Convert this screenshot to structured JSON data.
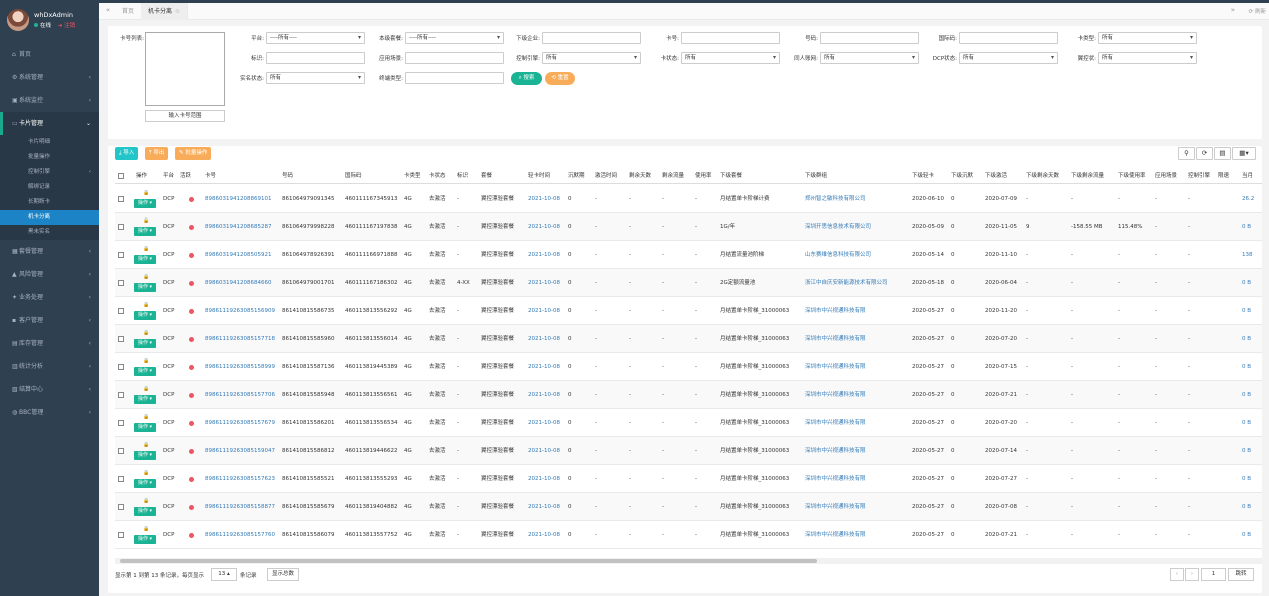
{
  "user": {
    "name": "whDxAdmin",
    "status": "在线",
    "logout": "注销"
  },
  "nav": {
    "items": [
      {
        "icon": "home-icon",
        "glyph": "⌂",
        "label": "首页",
        "arrow": ""
      },
      {
        "icon": "gear-icon",
        "glyph": "⚙",
        "label": "系统管理",
        "arrow": "‹"
      },
      {
        "icon": "video-icon",
        "glyph": "▣",
        "label": "系统监控",
        "arrow": "‹"
      },
      {
        "icon": "card-icon",
        "glyph": "▭",
        "label": "卡片管理",
        "arrow": "⌄"
      }
    ],
    "sub": [
      "卡片明细",
      "批量操作",
      "控制引擎",
      "解绑记录",
      "长期断卡",
      "机卡分离",
      "黑未实名"
    ],
    "sub_arrows": [
      "",
      "",
      "‹",
      "",
      "",
      "",
      ""
    ],
    "items2": [
      {
        "icon": "package-icon",
        "glyph": "▦",
        "label": "套餐管理",
        "arrow": "‹"
      },
      {
        "icon": "warning-icon",
        "glyph": "▲",
        "label": "风险管理",
        "arrow": "‹"
      },
      {
        "icon": "users-icon",
        "glyph": "✦",
        "label": "业务处理",
        "arrow": "‹"
      },
      {
        "icon": "customer-icon",
        "glyph": "▪",
        "label": "客户管理",
        "arrow": "‹"
      },
      {
        "icon": "warehouse-icon",
        "glyph": "▤",
        "label": "库存管理",
        "arrow": "‹"
      },
      {
        "icon": "chart-icon",
        "glyph": "▥",
        "label": "统计分析",
        "arrow": "‹"
      },
      {
        "icon": "settle-icon",
        "glyph": "▧",
        "label": "结算中心",
        "arrow": "‹"
      },
      {
        "icon": "globe-icon",
        "glyph": "◍",
        "label": "BBC管理",
        "arrow": "‹"
      }
    ]
  },
  "tabs": {
    "home": "首页",
    "active": "机卡分离",
    "refresh": "刷新"
  },
  "filters": {
    "card_list_label": "卡号列表:",
    "range_btn": "输入卡号范围",
    "platform": {
      "label": "平台:",
      "value": "----所有----"
    },
    "package": {
      "label": "本级套餐:",
      "value": "----所有----"
    },
    "lower_company": {
      "label": "下级企业:",
      "value": ""
    },
    "card_no": {
      "label": "卡号:",
      "value": ""
    },
    "number": {
      "label": "号码:",
      "value": ""
    },
    "iccid": {
      "label": "国际码:",
      "value": ""
    },
    "card_type": {
      "label": "卡类型:",
      "value": "所有"
    },
    "tag": {
      "label": "标识:",
      "value": ""
    },
    "scene": {
      "label": "应用场景:",
      "value": ""
    },
    "control_engine": {
      "label": "控制引擎:",
      "value": "所有"
    },
    "card_status": {
      "label": "卡状态:",
      "value": "所有"
    },
    "belong_pool": {
      "label": "同人账网:",
      "value": "所有"
    },
    "dcp_status": {
      "label": "DCP状态:",
      "value": "所有"
    },
    "wing_control": {
      "label": "翼控状:",
      "value": "所有"
    },
    "realname": {
      "label": "实名状态:",
      "value": "所有"
    },
    "terminal": {
      "label": "终端类型:",
      "value": ""
    },
    "search_btn": "搜索",
    "reset_btn": "重置"
  },
  "toolbar": {
    "import": "导入",
    "export": "导出",
    "batch": "批量操作"
  },
  "table": {
    "headers": [
      "操作",
      "平台",
      "活跃",
      "卡号",
      "号码",
      "国际码",
      "卡类型",
      "卡状态",
      "标识",
      "套餐",
      "轻卡时间",
      "沉默期",
      "激活时间",
      "剩余天数",
      "剩余流量",
      "使用率",
      "下级套餐",
      "下级群组",
      "下级轻卡",
      "下级沉默",
      "下级激活",
      "下级剩余天数",
      "下级剩余流量",
      "下级使用率",
      "应用场景",
      "控制引擎",
      "限速",
      "当月"
    ],
    "op_label": "操作",
    "rows": [
      [
        "DCP",
        "8986031941208869101",
        "861064979091345",
        "460111167345913",
        "4G",
        "去激活",
        "-",
        "翼控漂验套餐",
        "2021-10-08",
        "0",
        "-",
        "-",
        "-",
        "-",
        "月结置单卡阶梯计费",
        "郑州智之敏科技有限公司",
        "2020-06-10",
        "0",
        "2020-07-09",
        "-",
        "-",
        "-",
        "-",
        "-",
        "26.2"
      ],
      [
        "DCP",
        "8986031941208685287",
        "861064979998228",
        "460111167197838",
        "4G",
        "去激活",
        "-",
        "翼控漂验套餐",
        "2021-10-08",
        "0",
        "-",
        "-",
        "-",
        "-",
        "1G/年",
        "深圳开思信息技术有限公司",
        "2020-05-09",
        "0",
        "2020-11-05",
        "9",
        "-158.55 MB",
        "115.48%",
        "-",
        "-",
        "0 B"
      ],
      [
        "DCP",
        "8986031941208505921",
        "861064978926391",
        "460111166971888",
        "4G",
        "去激活",
        "-",
        "翼控漂验套餐",
        "2021-10-08",
        "0",
        "-",
        "-",
        "-",
        "-",
        "月结置流量池阶梯",
        "山东赛维信息科技有限公司",
        "2020-05-14",
        "0",
        "2020-11-10",
        "-",
        "-",
        "-",
        "-",
        "-",
        "138"
      ],
      [
        "DCP",
        "8986031941208684660",
        "861064979001701",
        "460111167186302",
        "4G",
        "去激活",
        "4-XX",
        "翼控漂验套餐",
        "2021-10-08",
        "0",
        "-",
        "-",
        "-",
        "-",
        "2G定额流量池",
        "浙江中自庆安新能源技术有限公司",
        "2020-05-18",
        "0",
        "2020-06-04",
        "-",
        "-",
        "-",
        "-",
        "-",
        "0 B"
      ],
      [
        "DCP",
        "89861119263085156909",
        "861410815586735",
        "460113813556292",
        "4G",
        "去激活",
        "-",
        "翼控漂验套餐",
        "2021-10-08",
        "0",
        "-",
        "-",
        "-",
        "-",
        "月结置单卡阶梯_31000063",
        "深圳市中兴视通科技有限",
        "2020-05-27",
        "0",
        "2020-11-20",
        "-",
        "-",
        "-",
        "-",
        "-",
        "0 B"
      ],
      [
        "DCP",
        "89861119263085157718",
        "861410815585960",
        "460113813556014",
        "4G",
        "去激活",
        "-",
        "翼控漂验套餐",
        "2021-10-08",
        "0",
        "-",
        "-",
        "-",
        "-",
        "月结置单卡阶梯_31000063",
        "深圳市中兴视通科技有限",
        "2020-05-27",
        "0",
        "2020-07-20",
        "-",
        "-",
        "-",
        "-",
        "-",
        "0 B"
      ],
      [
        "DCP",
        "89861119263085158999",
        "861410815587136",
        "460113819445389",
        "4G",
        "去激活",
        "-",
        "翼控漂验套餐",
        "2021-10-08",
        "0",
        "-",
        "-",
        "-",
        "-",
        "月结置单卡阶梯_31000063",
        "深圳市中兴视通科技有限",
        "2020-05-27",
        "0",
        "2020-07-15",
        "-",
        "-",
        "-",
        "-",
        "-",
        "0 B"
      ],
      [
        "DCP",
        "89861119263085157706",
        "861410815585948",
        "460113813556561",
        "4G",
        "去激活",
        "-",
        "翼控漂验套餐",
        "2021-10-08",
        "0",
        "-",
        "-",
        "-",
        "-",
        "月结置单卡阶梯_31000063",
        "深圳市中兴视通科技有限",
        "2020-05-27",
        "0",
        "2020-07-21",
        "-",
        "-",
        "-",
        "-",
        "-",
        "0 B"
      ],
      [
        "DCP",
        "89861119263085157679",
        "861410815586201",
        "460113813556534",
        "4G",
        "去激活",
        "-",
        "翼控漂验套餐",
        "2021-10-08",
        "0",
        "-",
        "-",
        "-",
        "-",
        "月结置单卡阶梯_31000063",
        "深圳市中兴视通科技有限",
        "2020-05-27",
        "0",
        "2020-07-20",
        "-",
        "-",
        "-",
        "-",
        "-",
        "0 B"
      ],
      [
        "DCP",
        "89861119263085159047",
        "861410815586812",
        "460113819446622",
        "4G",
        "去激活",
        "-",
        "翼控漂验套餐",
        "2021-10-08",
        "0",
        "-",
        "-",
        "-",
        "-",
        "月结置单卡阶梯_31000063",
        "深圳市中兴视通科技有限",
        "2020-05-27",
        "0",
        "2020-07-14",
        "-",
        "-",
        "-",
        "-",
        "-",
        "0 B"
      ],
      [
        "DCP",
        "89861119263085157623",
        "861410815585521",
        "460113813555293",
        "4G",
        "去激活",
        "-",
        "翼控漂验套餐",
        "2021-10-08",
        "0",
        "-",
        "-",
        "-",
        "-",
        "月结置单卡阶梯_31000063",
        "深圳市中兴视通科技有限",
        "2020-05-27",
        "0",
        "2020-07-27",
        "-",
        "-",
        "-",
        "-",
        "-",
        "0 B"
      ],
      [
        "DCP",
        "89861119263085158877",
        "861410815585679",
        "460113819404882",
        "4G",
        "去激活",
        "-",
        "翼控漂验套餐",
        "2021-10-08",
        "0",
        "-",
        "-",
        "-",
        "-",
        "月结置单卡阶梯_31000063",
        "深圳市中兴视通科技有限",
        "2020-05-27",
        "0",
        "2020-07-08",
        "-",
        "-",
        "-",
        "-",
        "-",
        "0 B"
      ],
      [
        "DCP",
        "89861119263085157760",
        "861410815586079",
        "460113813557752",
        "4G",
        "去激活",
        "-",
        "翼控漂验套餐",
        "2021-10-08",
        "0",
        "-",
        "-",
        "-",
        "-",
        "月结置单卡阶梯_31000063",
        "深圳市中兴视通科技有限",
        "2020-05-27",
        "0",
        "2020-07-21",
        "-",
        "-",
        "-",
        "-",
        "-",
        "0 B"
      ]
    ]
  },
  "pager": {
    "info": "显示第 1 到第 13 条记录，每页显示",
    "size": "13 ▴",
    "suffix": "条记录",
    "total_btn": "显示总数",
    "page": "1",
    "jump": "跳转",
    "prev": "‹",
    "next": "›"
  },
  "colors": {
    "sidebar": "#2f4050",
    "accent": "#1ab394",
    "active": "#1c84c6",
    "link": "#337ab7",
    "warn": "#f8ac59",
    "danger": "#ed5565"
  }
}
